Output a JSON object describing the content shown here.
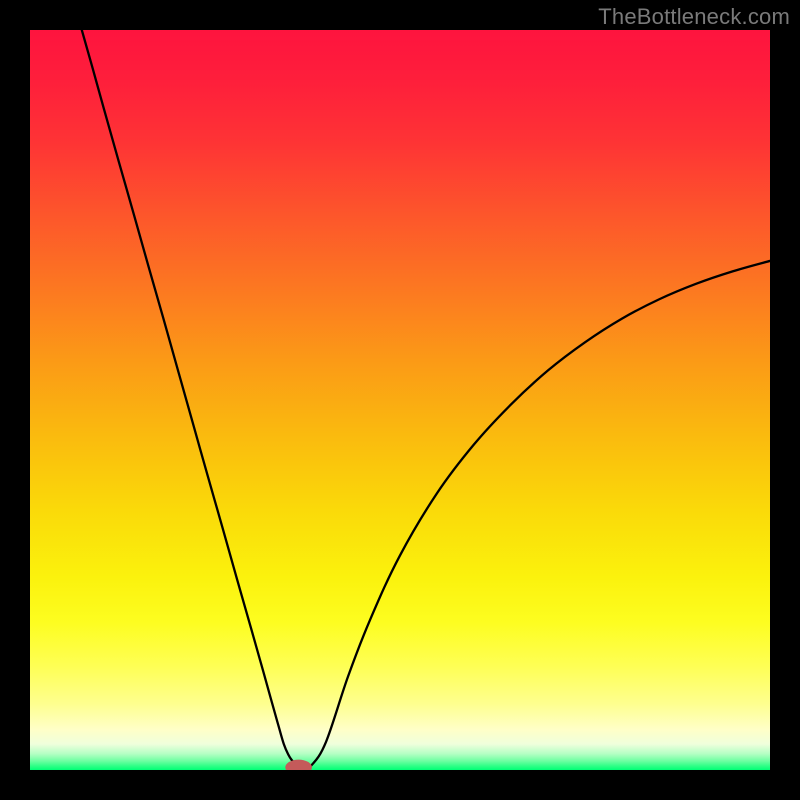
{
  "attribution": "TheBottleneck.com",
  "colors": {
    "page_bg": "#000000",
    "gradient_stops": [
      {
        "offset": 0.0,
        "color": "#fe143e"
      },
      {
        "offset": 0.07,
        "color": "#fe1f3b"
      },
      {
        "offset": 0.15,
        "color": "#fe3335"
      },
      {
        "offset": 0.25,
        "color": "#fd562b"
      },
      {
        "offset": 0.35,
        "color": "#fc7821"
      },
      {
        "offset": 0.45,
        "color": "#fb9b16"
      },
      {
        "offset": 0.55,
        "color": "#fabb0e"
      },
      {
        "offset": 0.65,
        "color": "#fada09"
      },
      {
        "offset": 0.74,
        "color": "#fbf20d"
      },
      {
        "offset": 0.8,
        "color": "#fdfd20"
      },
      {
        "offset": 0.86,
        "color": "#feff55"
      },
      {
        "offset": 0.91,
        "color": "#feff8e"
      },
      {
        "offset": 0.945,
        "color": "#ffffc7"
      },
      {
        "offset": 0.965,
        "color": "#efffdc"
      },
      {
        "offset": 0.978,
        "color": "#b5ffc4"
      },
      {
        "offset": 0.988,
        "color": "#6cffa1"
      },
      {
        "offset": 0.995,
        "color": "#2bff85"
      },
      {
        "offset": 1.0,
        "color": "#00ff76"
      }
    ],
    "curve_stroke": "#000000",
    "marker_fill": "#c45a5a"
  },
  "chart_data": {
    "type": "line",
    "title": "",
    "xlabel": "",
    "ylabel": "",
    "xlim": [
      0,
      100
    ],
    "ylim": [
      0,
      100
    ],
    "annotations": [
      {
        "text": "TheBottleneck.com",
        "position": "top-right"
      }
    ],
    "series": [
      {
        "name": "bottleneck-curve",
        "x": [
          7.0,
          8.5,
          10.0,
          12.0,
          14.0,
          16.0,
          18.0,
          20.0,
          22.0,
          24.0,
          26.0,
          28.0,
          30.0,
          31.5,
          32.7,
          33.6,
          34.3,
          34.9,
          35.4,
          35.9,
          36.5,
          37.1,
          38.0,
          40.0,
          43.0,
          46.0,
          50.0,
          55.0,
          60.0,
          65.0,
          70.0,
          75.0,
          80.0,
          85.0,
          90.0,
          95.0,
          100.0
        ],
        "y": [
          100.0,
          94.7,
          89.3,
          82.2,
          75.2,
          68.1,
          61.1,
          54.0,
          46.9,
          39.8,
          32.8,
          25.7,
          18.7,
          13.4,
          9.1,
          5.9,
          3.5,
          2.1,
          1.3,
          0.8,
          0.45,
          0.4,
          0.6,
          3.8,
          12.7,
          20.4,
          29.0,
          37.4,
          44.0,
          49.4,
          54.0,
          57.8,
          61.0,
          63.6,
          65.7,
          67.4,
          68.8
        ]
      }
    ],
    "marker": {
      "x": 36.3,
      "y": 0.35,
      "rx": 1.8,
      "ry": 1.05
    }
  }
}
